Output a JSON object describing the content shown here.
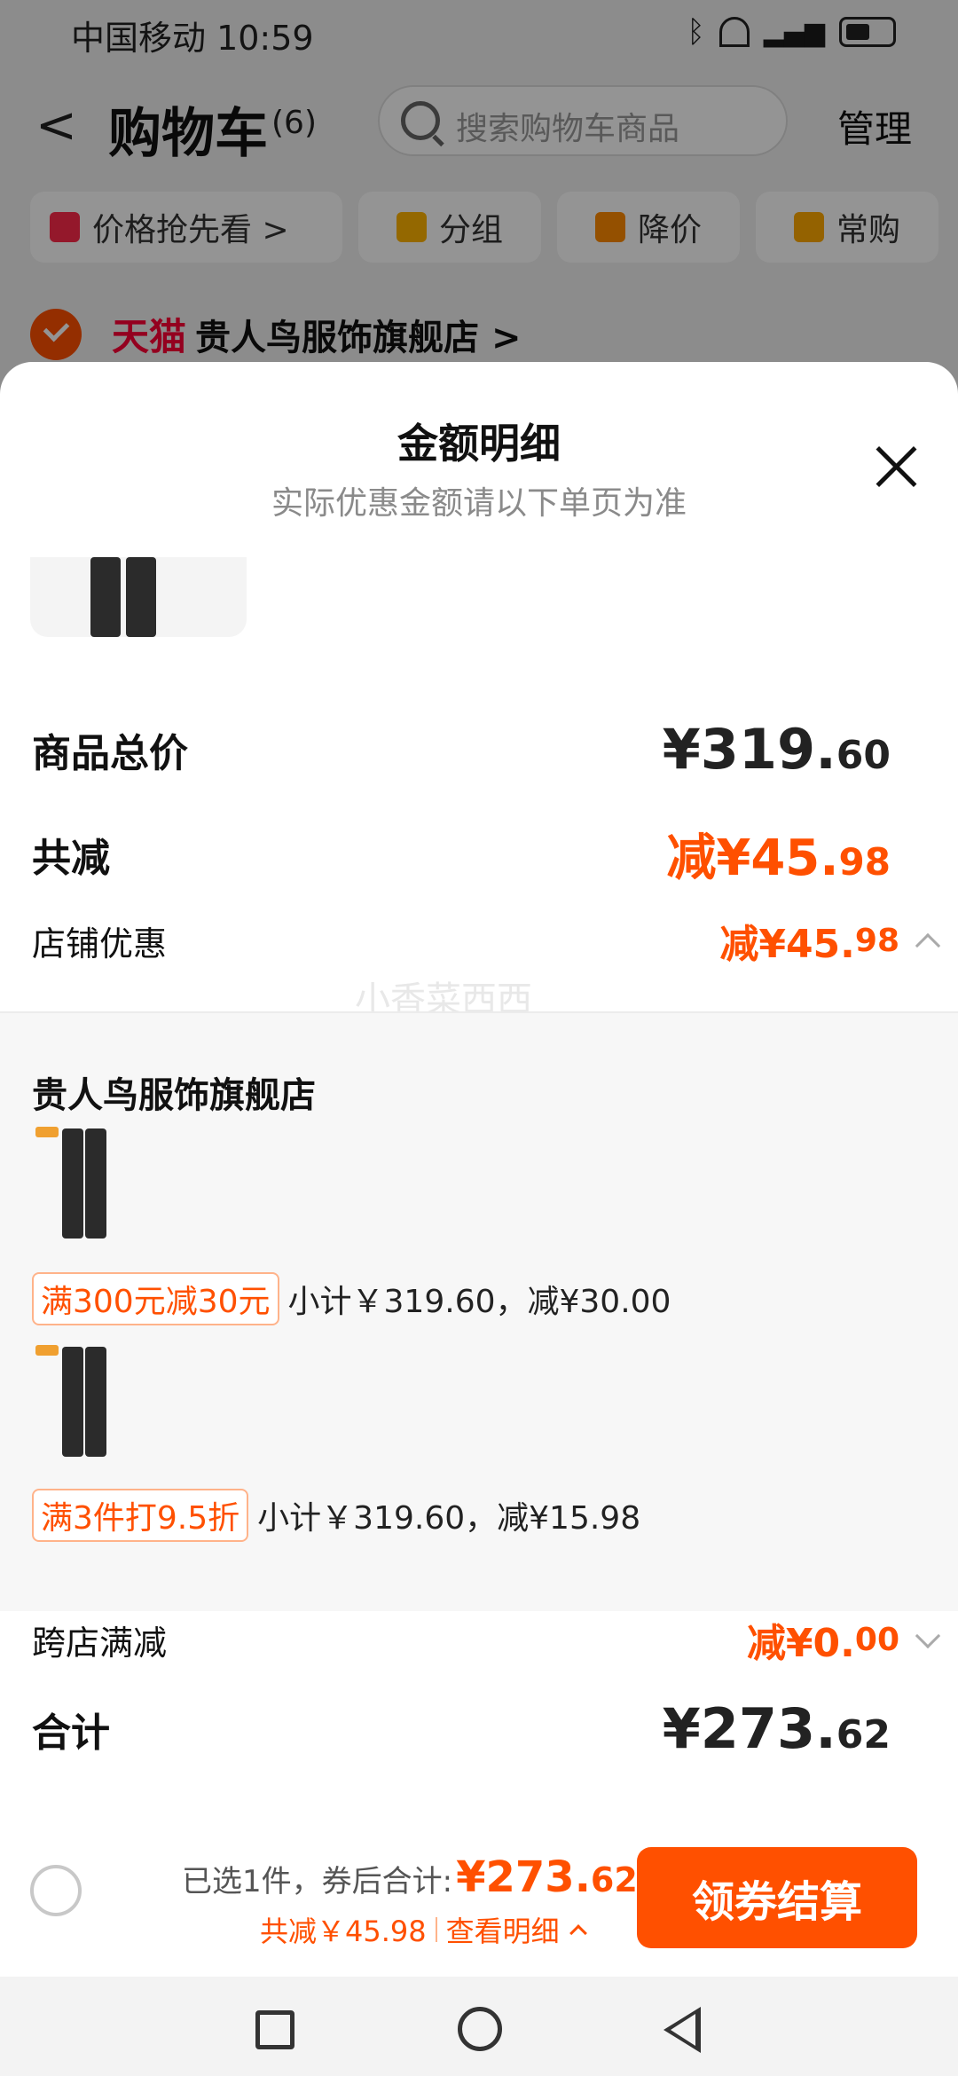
{
  "status_bar": {
    "carrier_time": "中国移动 10:59"
  },
  "header": {
    "title": "购物车",
    "count": "(6)",
    "search_placeholder": "搜索购物车商品",
    "manage": "管理"
  },
  "chips": [
    {
      "label": "价格抢先看 >",
      "icon": "price-tag-icon"
    },
    {
      "label": "分组",
      "icon": "folder-icon"
    },
    {
      "label": "降价",
      "icon": "price-drop-icon"
    },
    {
      "label": "常购",
      "icon": "cart-plus-icon"
    }
  ],
  "store": {
    "badge": "天猫",
    "name": "贵人鸟服饰旗舰店 >"
  },
  "sheet": {
    "title": "金额明细",
    "subtitle": "实际优惠金额请以下单页为准",
    "rows": {
      "subtotal_label": "商品总价",
      "subtotal_main": "¥319.",
      "subtotal_dec": "60",
      "reduce_label": "共减",
      "reduce_main": "减¥45.",
      "reduce_dec": "98",
      "shop_discount_label": "店铺优惠",
      "shop_discount_main": "减¥45.",
      "shop_discount_dec": "98",
      "cross_store_label": "跨店满减",
      "cross_store_main": "减¥0.",
      "cross_store_dec": "00",
      "total_label": "合计",
      "total_main": "¥273.",
      "total_dec": "62"
    },
    "watermark": "小香菜西西",
    "detail": {
      "store_name": "贵人鸟服饰旗舰店",
      "promos": [
        {
          "tag": "满300元减30元",
          "text": "小计￥319.60，减¥30.00"
        },
        {
          "tag": "满3件打9.5折",
          "text": "小计￥319.60，减¥15.98"
        }
      ]
    }
  },
  "bottom_bar": {
    "selected": "已选1件，券后合计:",
    "amount_main": "¥273.",
    "amount_dec": "62",
    "reduce_text": "共减￥45.98",
    "view_detail": "查看明细",
    "checkout": "领券结算"
  },
  "colors": {
    "accent": "#ff5000",
    "tmall": "#ff0036"
  }
}
